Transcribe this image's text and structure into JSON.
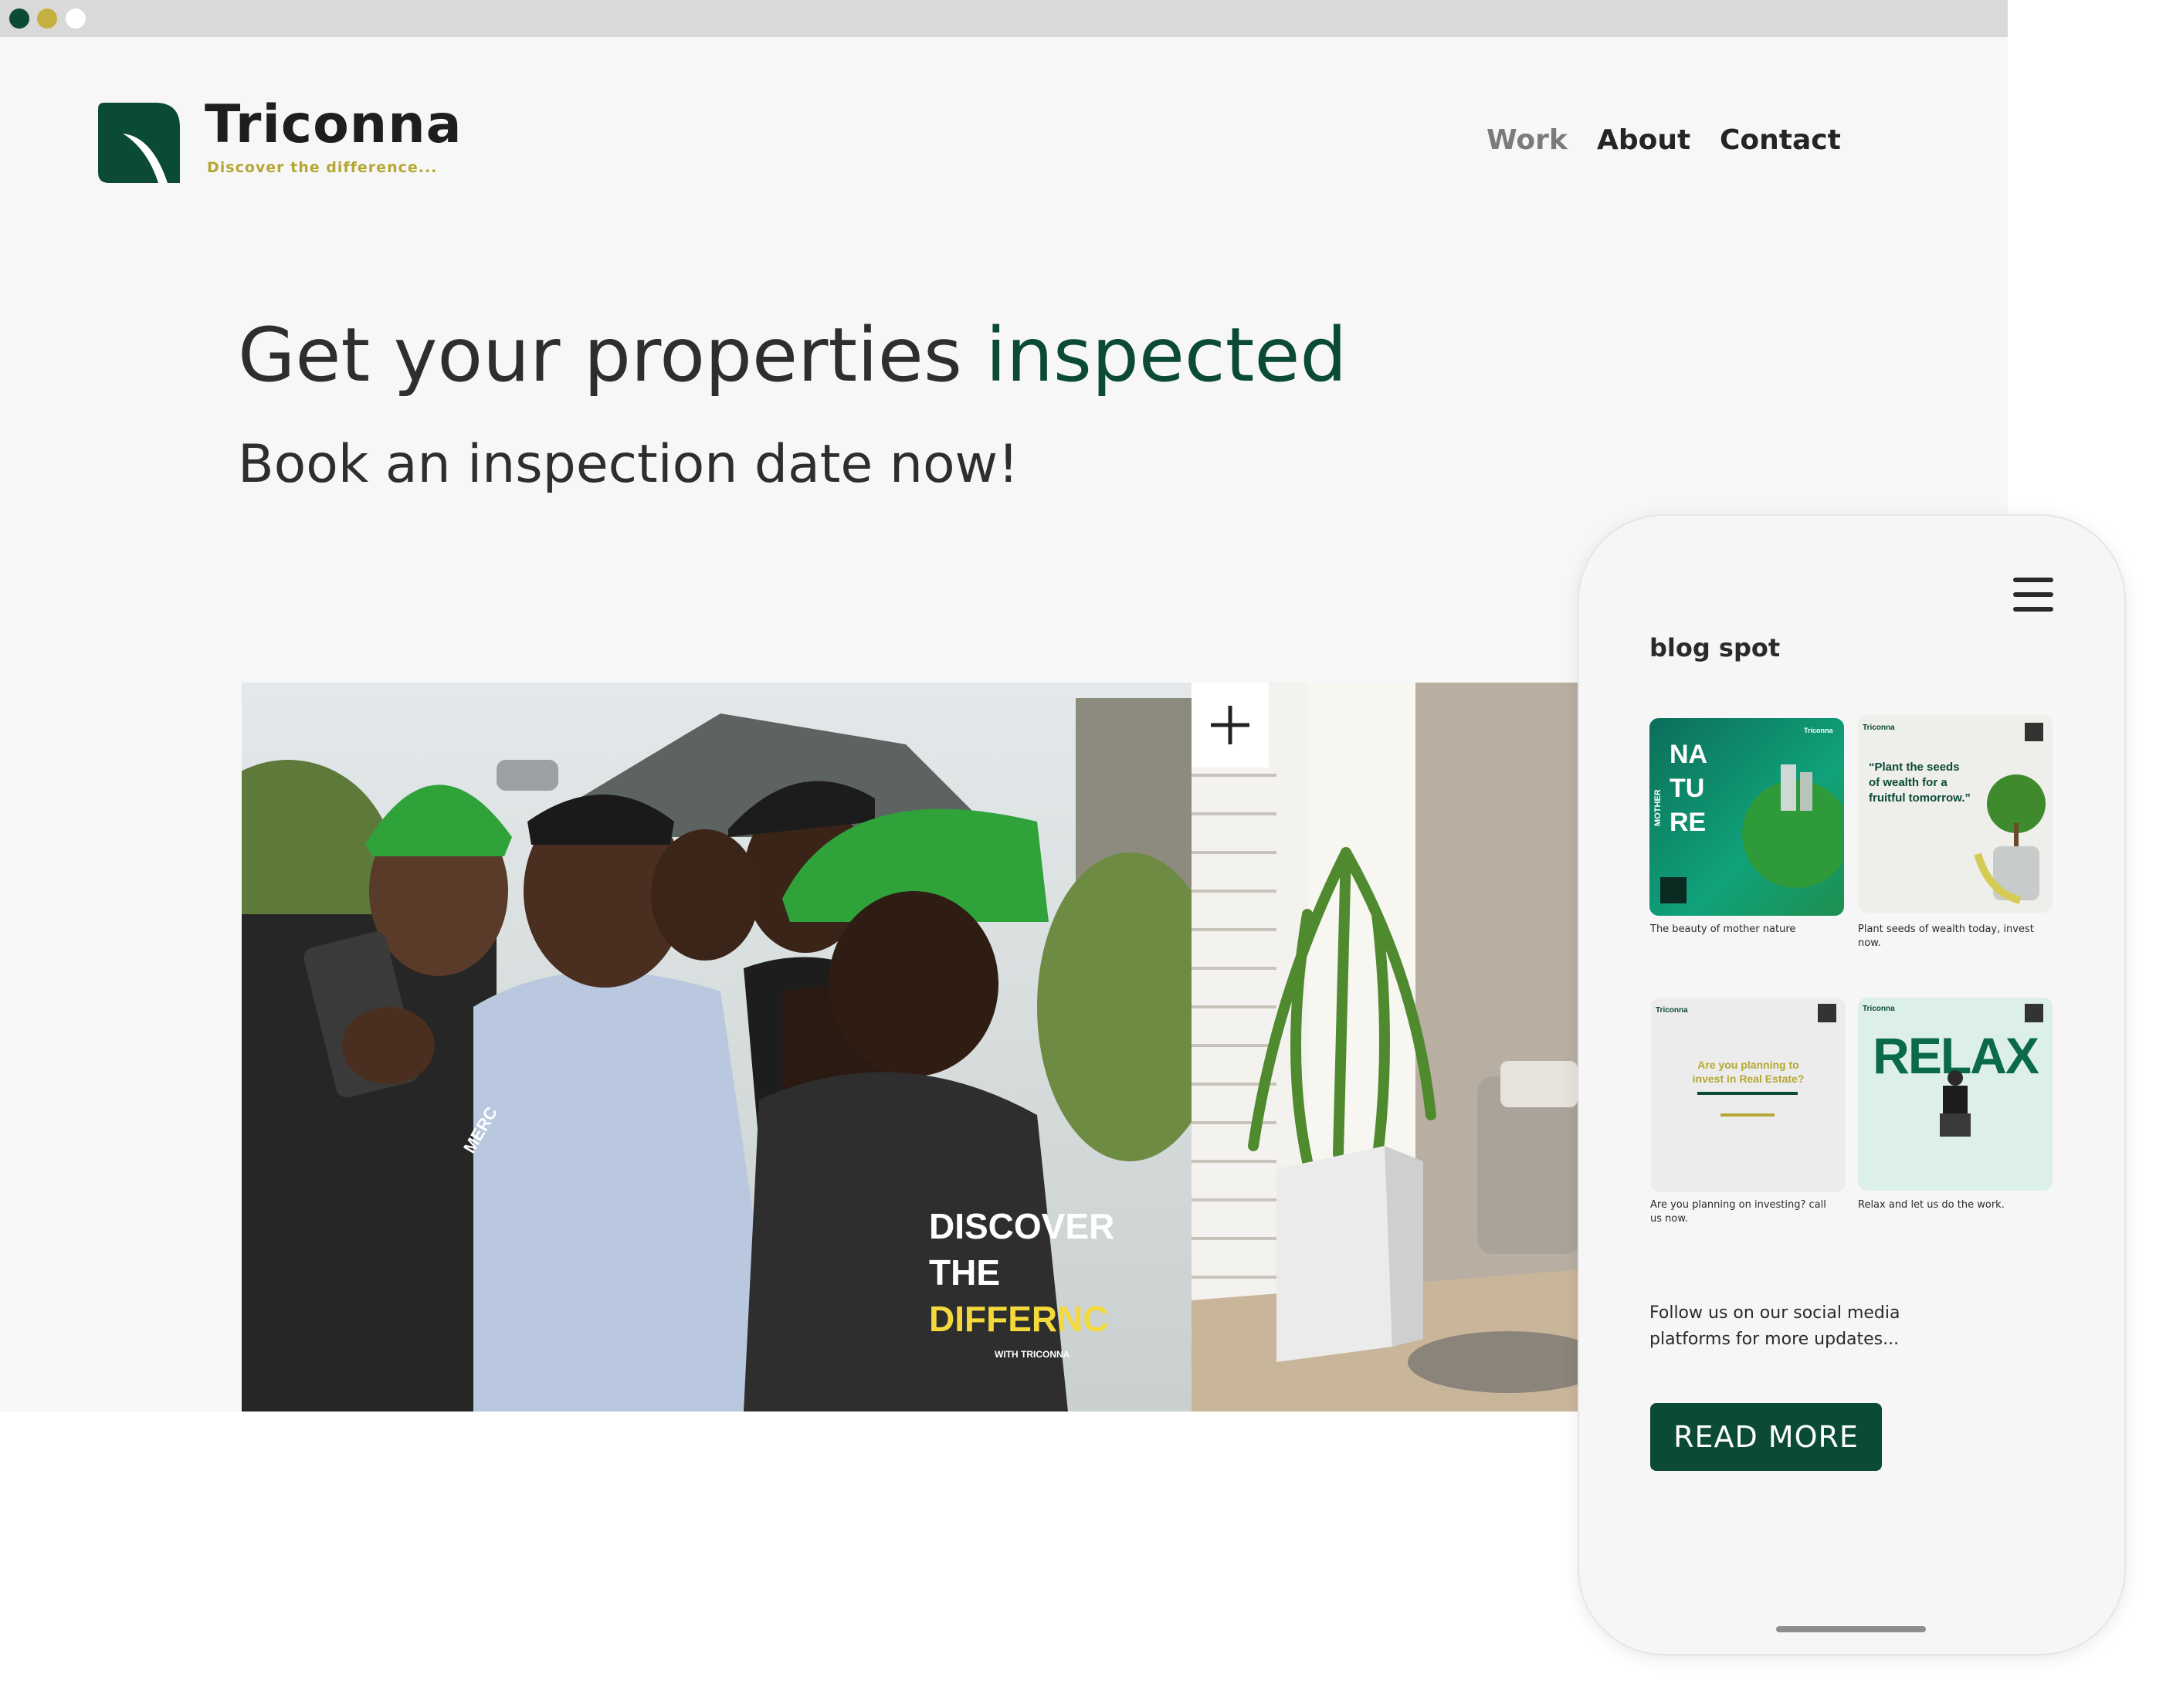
{
  "window": {
    "controls": [
      "close-dot",
      "minimize-dot",
      "maximize-dot"
    ]
  },
  "brand": {
    "name": "Triconna",
    "tagline": "Discover the difference..."
  },
  "nav": {
    "items": [
      {
        "label": "Work",
        "active": true
      },
      {
        "label": "About"
      },
      {
        "label": "Contact"
      }
    ]
  },
  "hero": {
    "headline_prefix": "Get your properties ",
    "headline_accent": "inspected",
    "subheadline": "Book an inspection date now!",
    "photo_shirt_text": [
      "DISCOVER",
      "THE",
      "DIFFERNC"
    ],
    "photo_shirt_small": "WITH TRICONNA",
    "photo_wrist_text": "MERC",
    "plus_label": "+"
  },
  "mobile": {
    "section_title": "blog spot",
    "cards": [
      {
        "caption": "The beauty of mother nature",
        "poster_lines": [
          "NA",
          "TU",
          "RE"
        ],
        "side_text": "MOTHER",
        "brand": "Triconna"
      },
      {
        "caption": "Plant seeds of wealth today, invest now.",
        "poster_lines": [
          "“Plant the seeds",
          "of wealth for a",
          "fruitful tomorrow.”"
        ],
        "brand": "Triconna"
      },
      {
        "caption": "Are you planning on investing? call us now.",
        "poster_lines": [
          "Are you planning to",
          "invest in Real Estate?"
        ],
        "brand": "Triconna"
      },
      {
        "caption": "Relax and let us do the work.",
        "poster_lines": [
          "RELAX"
        ],
        "brand": "Triconna"
      }
    ],
    "follow_text": "Follow us on our social media platforms for more updates...",
    "read_more_label": "READ MORE"
  },
  "colors": {
    "brand_green": "#0a4a37",
    "brand_gold": "#b5a733",
    "text_dark": "#2e2e2e",
    "nav_active": "#7b7b7b",
    "page_bg": "#f7f7f7"
  },
  "icons": [
    "triconna-logo-icon",
    "plus-icon",
    "hamburger-menu-icon"
  ]
}
